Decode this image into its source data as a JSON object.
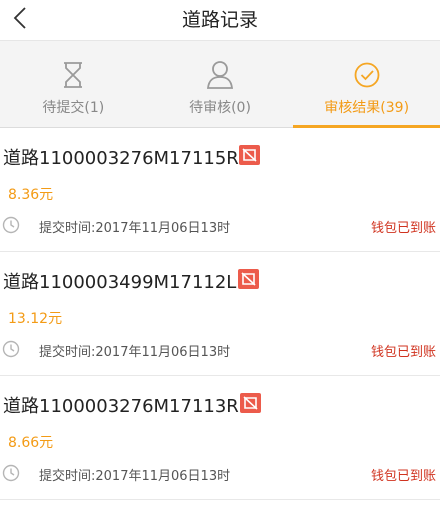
{
  "header": {
    "title": "道路记录",
    "back_icon": "chevron-left-icon"
  },
  "tabs": [
    {
      "label": "待提交(1)",
      "icon": "hourglass-icon",
      "active": false
    },
    {
      "label": "待审核(0)",
      "icon": "user-icon",
      "active": false
    },
    {
      "label": "审核结果(39)",
      "icon": "check-circle-icon",
      "active": true
    }
  ],
  "colors": {
    "accent": "#f5a623",
    "status": "#d0331f",
    "flag": "#ec5b4b"
  },
  "records": [
    {
      "title": "道路1100003276M17115R",
      "amount": "8.36元",
      "time": "提交时间:2017年11月06日13时",
      "status": "钱包已到账"
    },
    {
      "title": "道路1100003499M17112L",
      "amount": "13.12元",
      "time": "提交时间:2017年11月06日13时",
      "status": "钱包已到账"
    },
    {
      "title": "道路1100003276M17113R",
      "amount": "8.66元",
      "time": "提交时间:2017年11月06日13时",
      "status": "钱包已到账"
    }
  ]
}
